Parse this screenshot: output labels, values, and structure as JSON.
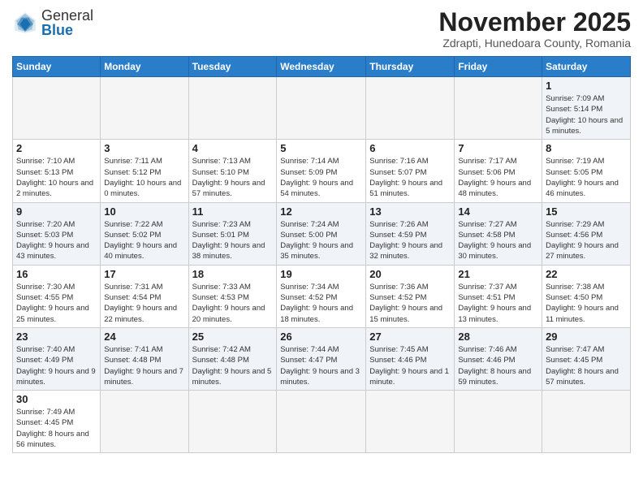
{
  "header": {
    "logo_general": "General",
    "logo_blue": "Blue",
    "month_title": "November 2025",
    "location": "Zdrapti, Hunedoara County, Romania"
  },
  "days_of_week": [
    "Sunday",
    "Monday",
    "Tuesday",
    "Wednesday",
    "Thursday",
    "Friday",
    "Saturday"
  ],
  "weeks": [
    [
      {
        "day": "",
        "info": ""
      },
      {
        "day": "",
        "info": ""
      },
      {
        "day": "",
        "info": ""
      },
      {
        "day": "",
        "info": ""
      },
      {
        "day": "",
        "info": ""
      },
      {
        "day": "",
        "info": ""
      },
      {
        "day": "1",
        "info": "Sunrise: 7:09 AM\nSunset: 5:14 PM\nDaylight: 10 hours and 5 minutes."
      }
    ],
    [
      {
        "day": "2",
        "info": "Sunrise: 7:10 AM\nSunset: 5:13 PM\nDaylight: 10 hours and 2 minutes."
      },
      {
        "day": "3",
        "info": "Sunrise: 7:11 AM\nSunset: 5:12 PM\nDaylight: 10 hours and 0 minutes."
      },
      {
        "day": "4",
        "info": "Sunrise: 7:13 AM\nSunset: 5:10 PM\nDaylight: 9 hours and 57 minutes."
      },
      {
        "day": "5",
        "info": "Sunrise: 7:14 AM\nSunset: 5:09 PM\nDaylight: 9 hours and 54 minutes."
      },
      {
        "day": "6",
        "info": "Sunrise: 7:16 AM\nSunset: 5:07 PM\nDaylight: 9 hours and 51 minutes."
      },
      {
        "day": "7",
        "info": "Sunrise: 7:17 AM\nSunset: 5:06 PM\nDaylight: 9 hours and 48 minutes."
      },
      {
        "day": "8",
        "info": "Sunrise: 7:19 AM\nSunset: 5:05 PM\nDaylight: 9 hours and 46 minutes."
      }
    ],
    [
      {
        "day": "9",
        "info": "Sunrise: 7:20 AM\nSunset: 5:03 PM\nDaylight: 9 hours and 43 minutes."
      },
      {
        "day": "10",
        "info": "Sunrise: 7:22 AM\nSunset: 5:02 PM\nDaylight: 9 hours and 40 minutes."
      },
      {
        "day": "11",
        "info": "Sunrise: 7:23 AM\nSunset: 5:01 PM\nDaylight: 9 hours and 38 minutes."
      },
      {
        "day": "12",
        "info": "Sunrise: 7:24 AM\nSunset: 5:00 PM\nDaylight: 9 hours and 35 minutes."
      },
      {
        "day": "13",
        "info": "Sunrise: 7:26 AM\nSunset: 4:59 PM\nDaylight: 9 hours and 32 minutes."
      },
      {
        "day": "14",
        "info": "Sunrise: 7:27 AM\nSunset: 4:58 PM\nDaylight: 9 hours and 30 minutes."
      },
      {
        "day": "15",
        "info": "Sunrise: 7:29 AM\nSunset: 4:56 PM\nDaylight: 9 hours and 27 minutes."
      }
    ],
    [
      {
        "day": "16",
        "info": "Sunrise: 7:30 AM\nSunset: 4:55 PM\nDaylight: 9 hours and 25 minutes."
      },
      {
        "day": "17",
        "info": "Sunrise: 7:31 AM\nSunset: 4:54 PM\nDaylight: 9 hours and 22 minutes."
      },
      {
        "day": "18",
        "info": "Sunrise: 7:33 AM\nSunset: 4:53 PM\nDaylight: 9 hours and 20 minutes."
      },
      {
        "day": "19",
        "info": "Sunrise: 7:34 AM\nSunset: 4:52 PM\nDaylight: 9 hours and 18 minutes."
      },
      {
        "day": "20",
        "info": "Sunrise: 7:36 AM\nSunset: 4:52 PM\nDaylight: 9 hours and 15 minutes."
      },
      {
        "day": "21",
        "info": "Sunrise: 7:37 AM\nSunset: 4:51 PM\nDaylight: 9 hours and 13 minutes."
      },
      {
        "day": "22",
        "info": "Sunrise: 7:38 AM\nSunset: 4:50 PM\nDaylight: 9 hours and 11 minutes."
      }
    ],
    [
      {
        "day": "23",
        "info": "Sunrise: 7:40 AM\nSunset: 4:49 PM\nDaylight: 9 hours and 9 minutes."
      },
      {
        "day": "24",
        "info": "Sunrise: 7:41 AM\nSunset: 4:48 PM\nDaylight: 9 hours and 7 minutes."
      },
      {
        "day": "25",
        "info": "Sunrise: 7:42 AM\nSunset: 4:48 PM\nDaylight: 9 hours and 5 minutes."
      },
      {
        "day": "26",
        "info": "Sunrise: 7:44 AM\nSunset: 4:47 PM\nDaylight: 9 hours and 3 minutes."
      },
      {
        "day": "27",
        "info": "Sunrise: 7:45 AM\nSunset: 4:46 PM\nDaylight: 9 hours and 1 minute."
      },
      {
        "day": "28",
        "info": "Sunrise: 7:46 AM\nSunset: 4:46 PM\nDaylight: 8 hours and 59 minutes."
      },
      {
        "day": "29",
        "info": "Sunrise: 7:47 AM\nSunset: 4:45 PM\nDaylight: 8 hours and 57 minutes."
      }
    ],
    [
      {
        "day": "30",
        "info": "Sunrise: 7:49 AM\nSunset: 4:45 PM\nDaylight: 8 hours and 56 minutes."
      },
      {
        "day": "",
        "info": ""
      },
      {
        "day": "",
        "info": ""
      },
      {
        "day": "",
        "info": ""
      },
      {
        "day": "",
        "info": ""
      },
      {
        "day": "",
        "info": ""
      },
      {
        "day": "",
        "info": ""
      }
    ]
  ]
}
